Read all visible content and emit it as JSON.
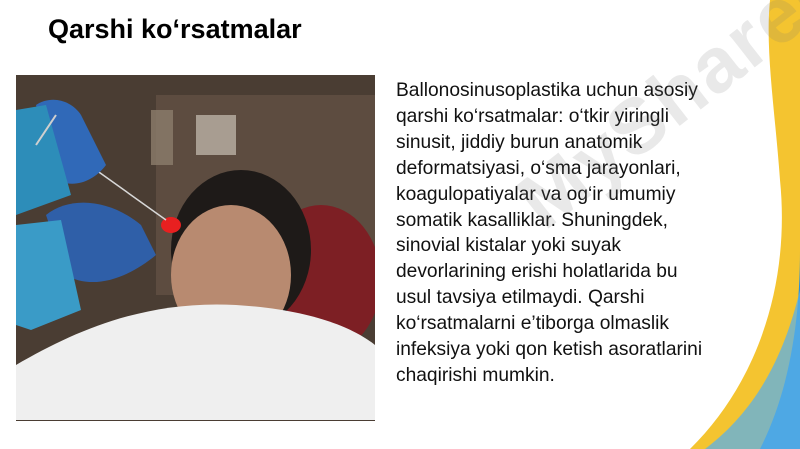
{
  "slide": {
    "title": "Qarshi ko‘rsatmalar",
    "body_lines": [
      "Ballonosinusoplastika uchun asosiy",
      "qarshi ko‘rsatmalar: o‘tkir yiringli",
      "sinusit, jiddiy burun anatomik",
      "deformatsiyasi, o‘sma jarayonlari,",
      "koagulopatiyalar va og‘ir umumiy",
      "somatik kasalliklar. Shuningdek,",
      "sinovial kistalar yoki suyak",
      "devorlarining erishi holatlarida bu",
      "usul tavsiya etilmaydi. Qarshi",
      "ko‘rsatmalarni e’tiborga olmaslik",
      "infeksiya yoki qon ketish asoratlarini",
      "chaqirishi mumkin."
    ]
  },
  "watermark": {
    "text": "MyShared"
  },
  "colors": {
    "accent_blue": "#2b8fd6",
    "accent_yellow": "#f4c430",
    "text": "#111111"
  }
}
